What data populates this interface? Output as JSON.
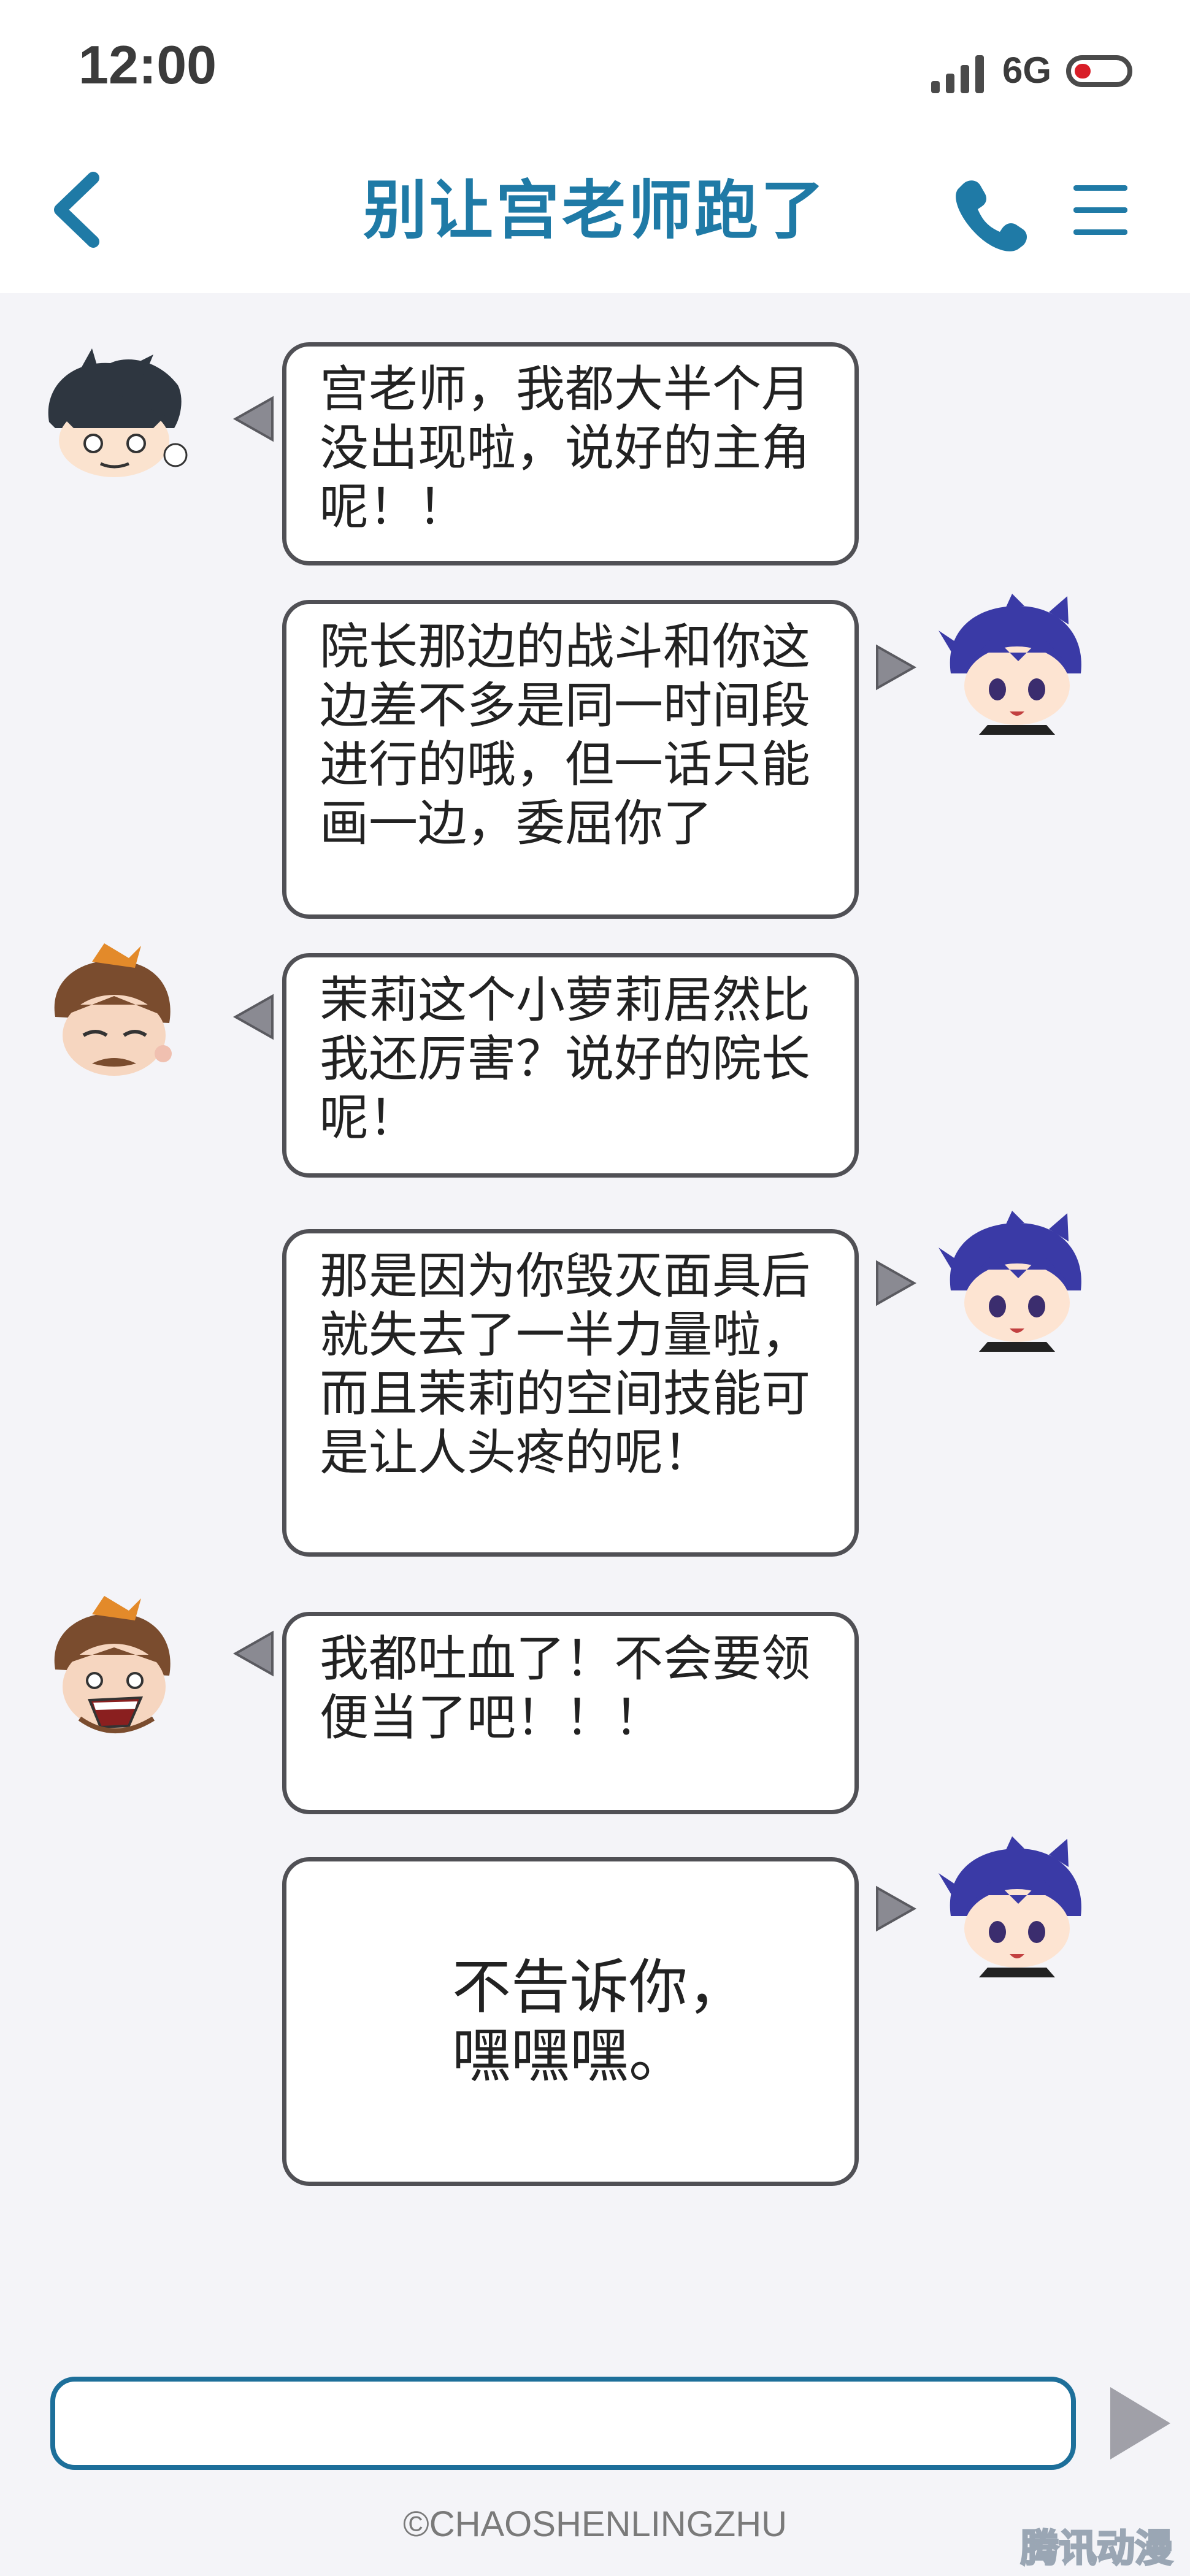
{
  "status_bar": {
    "time": "12:00",
    "network": "6G",
    "icons": [
      "signal-bars-icon",
      "battery-low-icon"
    ]
  },
  "header": {
    "title": "别让宫老师跑了",
    "icons": [
      "back-arrow-icon",
      "phone-icon",
      "menu-icon"
    ],
    "accent_color": "#1f7aa6"
  },
  "messages": [
    {
      "side": "left",
      "avatar": "dark-haired-boy-avatar",
      "text": "宫老师，我都大半个月\n没出现啦，说好的主角\n呢！！"
    },
    {
      "side": "right",
      "avatar": "blue-haired-boy-avatar",
      "text": "院长那边的战斗和你这\n边差不多是同一时间段\n进行的哦，但一话只能\n画一边，委屈你了"
    },
    {
      "side": "left",
      "avatar": "brown-haired-man-avatar",
      "text": "茉莉这个小萝莉居然比\n我还厉害？说好的院长\n呢！"
    },
    {
      "side": "right",
      "avatar": "blue-haired-boy-avatar",
      "text": "那是因为你毁灭面具后\n就失去了一半力量啦，\n而且茉莉的空间技能可\n是让人头疼的呢！"
    },
    {
      "side": "left",
      "avatar": "shouting-man-avatar",
      "text": "我都吐血了！不会要领\n便当了吧！！！"
    },
    {
      "side": "right",
      "avatar": "blue-haired-boy-avatar",
      "text": "不告诉你，\n嘿嘿嘿。"
    }
  ],
  "input": {
    "value": "",
    "placeholder": ""
  },
  "footer": {
    "copyright": "©CHAOSHENLINGZHU",
    "watermark": "腾讯动漫"
  },
  "colors": {
    "background": "#f4f4f8",
    "bubble_border": "#505055",
    "pointer": "#8a8a92",
    "input_border": "#1d6f9a"
  }
}
